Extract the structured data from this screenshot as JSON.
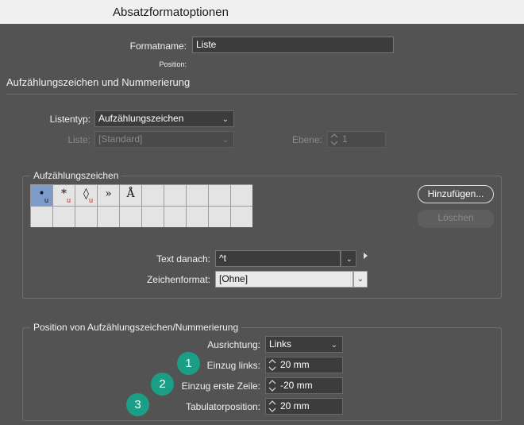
{
  "window": {
    "title": "Absatzformatoptionen"
  },
  "format_name": {
    "label": "Formatname:",
    "value": "Liste"
  },
  "position_label": "Position:",
  "section_title": "Aufzählungszeichen und Nummerierung",
  "list_type": {
    "label": "Listentyp:",
    "value": "Aufzählungszeichen"
  },
  "list": {
    "label": "Liste:",
    "value": "[Standard]"
  },
  "level": {
    "label": "Ebene:",
    "value": "1"
  },
  "bullets_group": {
    "title": "Aufzählungszeichen",
    "glyphs": [
      {
        "char": "•",
        "sub": "u",
        "selected": true
      },
      {
        "char": "*",
        "sub": "u",
        "selected": false
      },
      {
        "char": "◊",
        "sub": "u",
        "selected": false
      },
      {
        "char": "»",
        "sub": "",
        "selected": false
      },
      {
        "char": "Å",
        "sub": "",
        "selected": false
      }
    ],
    "add_button": "Hinzufügen...",
    "delete_button": "Löschen",
    "text_after": {
      "label": "Text danach:",
      "value": "^t"
    },
    "char_style": {
      "label": "Zeichenformat:",
      "value": "[Ohne]"
    }
  },
  "position_group": {
    "title": "Position von Aufzählungszeichen/Nummerierung",
    "alignment": {
      "label": "Ausrichtung:",
      "value": "Links"
    },
    "left_indent": {
      "label": "Einzug links:",
      "value": "20 mm",
      "badge": "1"
    },
    "first_line_indent": {
      "label": "Einzug erste Zeile:",
      "value": "-20 mm",
      "badge": "2"
    },
    "tab_position": {
      "label": "Tabulatorposition:",
      "value": "20 mm",
      "badge": "3"
    }
  },
  "colors": {
    "badge": "#1a9e86",
    "selected_cell": "#7d9cc9",
    "panel": "#535353"
  }
}
